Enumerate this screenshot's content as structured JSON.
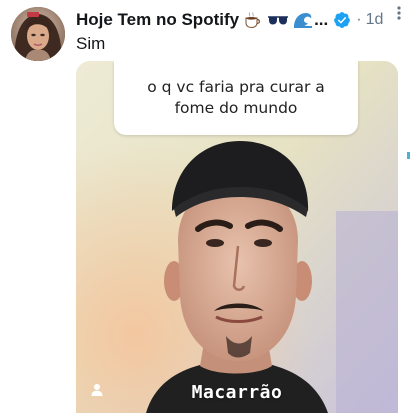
{
  "tweet": {
    "display_name": "Hoje Tem no Spotify",
    "name_truncation": "...",
    "separator": "·",
    "timestamp": "1d",
    "text": "Sim",
    "emojis": [
      "coffee-icon",
      "sunglasses-icon",
      "wave-icon"
    ]
  },
  "media": {
    "question": "o q vc faria pra curar a fome do mundo",
    "answer": "Macarrão"
  },
  "colors": {
    "verified_blue": "#1da1f2",
    "secondary_text": "#657786",
    "primary_text": "#14171a"
  }
}
